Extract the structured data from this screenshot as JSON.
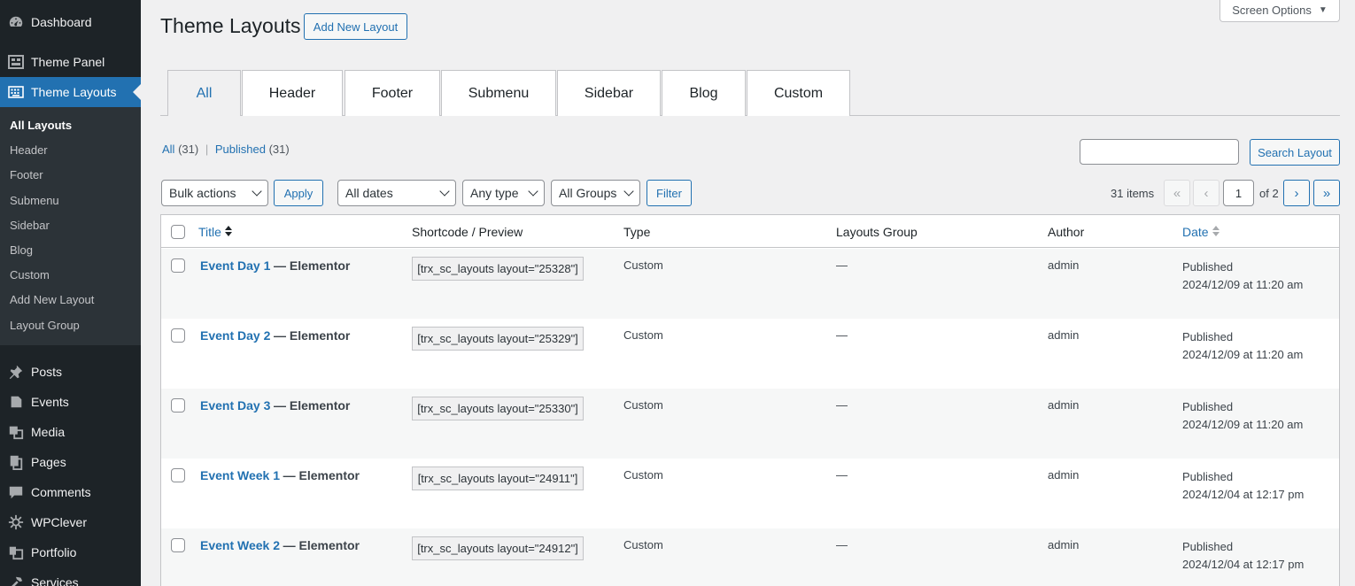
{
  "sidebar": {
    "top_items": [
      {
        "label": "Dashboard",
        "icon": "dashboard-icon"
      },
      {
        "label": "Theme Panel",
        "icon": "theme-panel-icon"
      },
      {
        "label": "Theme Layouts",
        "icon": "keyboard-icon"
      }
    ],
    "submenu": [
      "All Layouts",
      "Header",
      "Footer",
      "Submenu",
      "Sidebar",
      "Blog",
      "Custom",
      "Add New Layout",
      "Layout Group"
    ],
    "bottom_items": [
      {
        "label": "Posts",
        "icon": "pin-icon"
      },
      {
        "label": "Events",
        "icon": "events-icon"
      },
      {
        "label": "Media",
        "icon": "media-icon"
      },
      {
        "label": "Pages",
        "icon": "pages-icon"
      },
      {
        "label": "Comments",
        "icon": "comments-icon"
      },
      {
        "label": "WPClever",
        "icon": "gear-icon"
      },
      {
        "label": "Portfolio",
        "icon": "portfolio-icon"
      },
      {
        "label": "Services",
        "icon": "hammer-icon"
      }
    ]
  },
  "header": {
    "title": "Theme Layouts",
    "add_new": "Add New Layout",
    "screen_options": "Screen Options"
  },
  "tabs": [
    "All",
    "Header",
    "Footer",
    "Submenu",
    "Sidebar",
    "Blog",
    "Custom"
  ],
  "views": {
    "all_label": "All",
    "all_count": "(31)",
    "separator": "|",
    "published_label": "Published",
    "published_count": "(31)"
  },
  "search": {
    "button": "Search Layout",
    "value": ""
  },
  "filters": {
    "bulk": "Bulk actions",
    "apply": "Apply",
    "dates": "All dates",
    "type": "Any type",
    "groups": "All Groups",
    "filter": "Filter"
  },
  "pagination": {
    "items": "31 items",
    "first": "«",
    "prev": "‹",
    "current": "1",
    "of": "of 2",
    "next": "›",
    "last": "»"
  },
  "columns": [
    "Title",
    "Shortcode / Preview",
    "Type",
    "Layouts Group",
    "Author",
    "Date"
  ],
  "rows": [
    {
      "title": "Event Day 1",
      "suffix": "— Elementor",
      "shortcode": "[trx_sc_layouts layout=\"25328\"]",
      "type": "Custom",
      "group": "—",
      "author": "admin",
      "status": "Published",
      "date": "2024/12/09 at 11:20 am"
    },
    {
      "title": "Event Day 2",
      "suffix": "— Elementor",
      "shortcode": "[trx_sc_layouts layout=\"25329\"]",
      "type": "Custom",
      "group": "—",
      "author": "admin",
      "status": "Published",
      "date": "2024/12/09 at 11:20 am"
    },
    {
      "title": "Event Day 3",
      "suffix": "— Elementor",
      "shortcode": "[trx_sc_layouts layout=\"25330\"]",
      "type": "Custom",
      "group": "—",
      "author": "admin",
      "status": "Published",
      "date": "2024/12/09 at 11:20 am"
    },
    {
      "title": "Event Week 1",
      "suffix": "— Elementor",
      "shortcode": "[trx_sc_layouts layout=\"24911\"]",
      "type": "Custom",
      "group": "—",
      "author": "admin",
      "status": "Published",
      "date": "2024/12/04 at 12:17 pm"
    },
    {
      "title": "Event Week 2",
      "suffix": "— Elementor",
      "shortcode": "[trx_sc_layouts layout=\"24912\"]",
      "type": "Custom",
      "group": "—",
      "author": "admin",
      "status": "Published",
      "date": "2024/12/04 at 12:17 pm"
    }
  ],
  "colors": {
    "sidebar_bg": "#1d2327",
    "accent": "#2271b1",
    "page_bg": "#f0f0f1"
  }
}
